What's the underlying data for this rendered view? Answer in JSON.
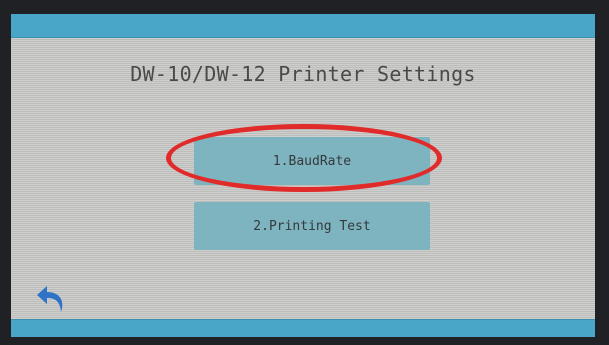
{
  "screen": {
    "title": "DW-10/DW-12 Printer Settings",
    "menu": [
      {
        "label": "1.BaudRate",
        "highlighted": true
      },
      {
        "label": "2.Printing Test",
        "highlighted": false
      }
    ],
    "back_icon": "undo-arrow-icon"
  },
  "colors": {
    "bar": "#4aa6c9",
    "button": "#7eb4bf",
    "background": "#c9c9c7",
    "highlight_ring": "#e12a2a",
    "back_icon": "#2f73c9"
  }
}
